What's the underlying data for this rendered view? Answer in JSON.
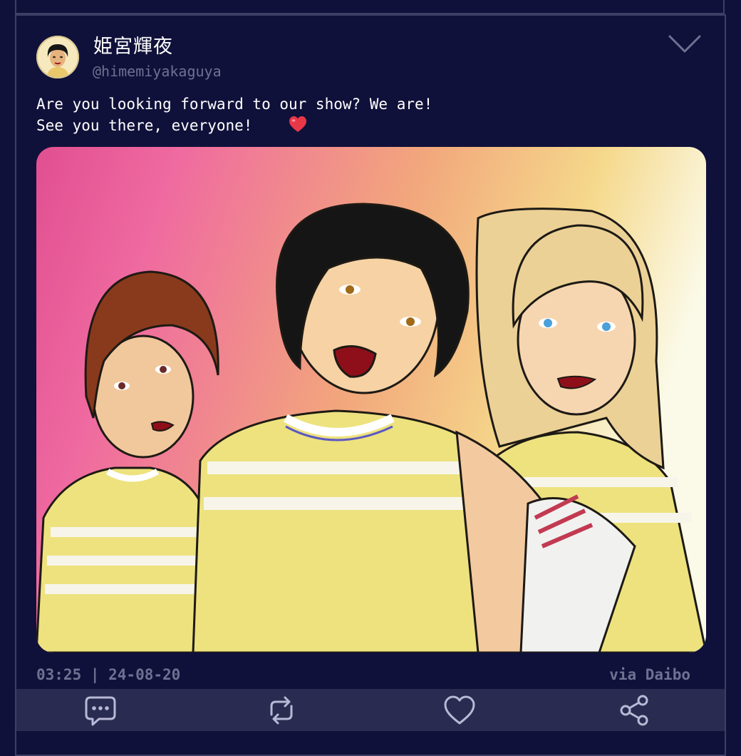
{
  "post": {
    "display_name": "姫宮輝夜",
    "handle": "@himemiyakaguya",
    "text": "Are you looking forward to our show? We are!\nSee you there, everyone!",
    "emoji": "heart-emoji",
    "image_description_icon": "illustration-three-girls",
    "time": "03:25 | 24-08-20",
    "source": "via Daibo"
  },
  "icons": {
    "menu": "chevron-down-icon",
    "reply": "comment-bubble-icon",
    "repost": "repost-icon",
    "like": "heart-icon",
    "share": "share-icon"
  },
  "colors": {
    "background": "#10113a",
    "border": "#3d3f66",
    "muted": "#6f7192",
    "action_bar": "#2a2b50",
    "heart": "#e83848"
  }
}
